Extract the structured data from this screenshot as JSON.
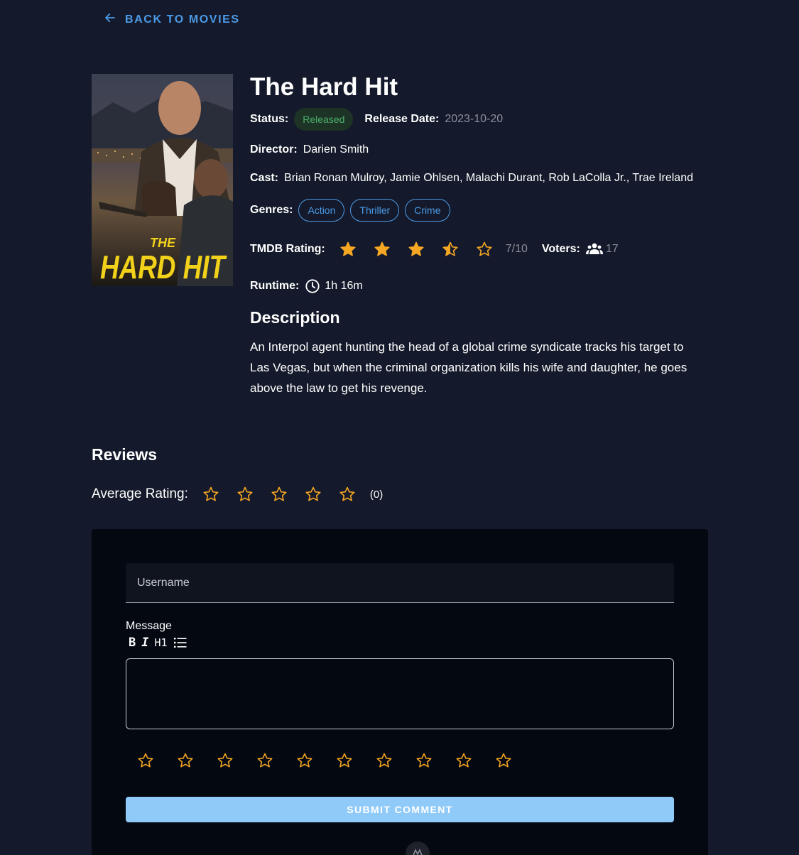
{
  "nav": {
    "back_label": "BACK TO MOVIES"
  },
  "movie": {
    "title": "The Hard Hit",
    "poster_text_top": "THE",
    "poster_text_main": "HARD HIT",
    "status_label": "Status:",
    "status": "Released",
    "release_label": "Release Date:",
    "release_date": "2023-10-20",
    "director_label": "Director:",
    "director": "Darien Smith",
    "cast_label": "Cast:",
    "cast": "Brian Ronan Mulroy, Jamie Ohlsen, Malachi Durant, Rob LaColla Jr., Trae Ireland",
    "genres_label": "Genres:",
    "genres": [
      "Action",
      "Thriller",
      "Crime"
    ],
    "tmdb_label": "TMDB Rating:",
    "tmdb_rating_text": "7/10",
    "tmdb_stars": 3.5,
    "voters_label": "Voters:",
    "voters": "17",
    "runtime_label": "Runtime:",
    "runtime": "1h 16m",
    "description_heading": "Description",
    "description": "An Interpol agent hunting the head of a global crime syndicate tracks his target to Las Vegas, but when the criminal organization kills his wife and daughter, he goes above the law to get his revenge."
  },
  "reviews": {
    "heading": "Reviews",
    "average_label": "Average Rating:",
    "average_stars": 0,
    "count_text": "(0)"
  },
  "form": {
    "username_placeholder": "Username",
    "message_label": "Message",
    "toolbar": {
      "bold": "B",
      "italic": "I",
      "heading": "H1"
    },
    "rating_stars": 10,
    "submit_label": "SUBMIT COMMENT"
  },
  "colors": {
    "background": "#141a2b",
    "card": "#040811",
    "accent": "#4c9be8",
    "star": "#f5a623",
    "status_green": "#4caf6a",
    "submit": "#90caf9"
  },
  "icons": {
    "back": "arrow-left-icon",
    "voters": "group-icon",
    "runtime": "clock-icon",
    "list": "bulleted-list-icon"
  }
}
